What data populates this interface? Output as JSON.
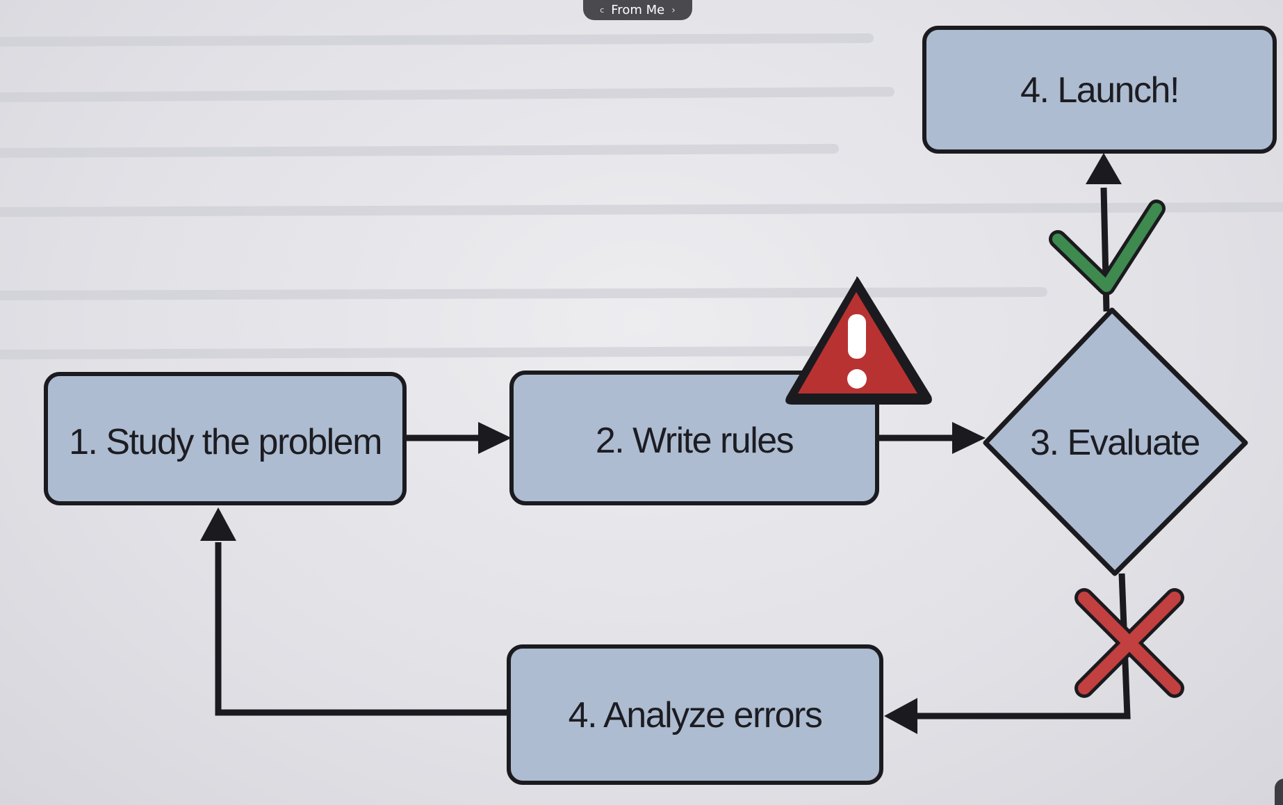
{
  "toolbar": {
    "source_label": "From Me",
    "source_icon": "c-icon",
    "chevron_icon": "chevron-right-icon"
  },
  "diagram": {
    "nodes": {
      "study": "1. Study the problem",
      "write": "2. Write rules",
      "evaluate": "3. Evaluate",
      "analyze": "4. Analyze errors",
      "launch": "4. Launch!"
    },
    "icons": {
      "warning": "warning-triangle-icon",
      "success": "checkmark-icon",
      "failure": "cross-icon"
    },
    "colors": {
      "box_fill": "#adbcd0",
      "outline": "#1b1b1f",
      "warning": "#b83232",
      "check": "#3e8a4f",
      "cross": "#c2403f"
    }
  }
}
